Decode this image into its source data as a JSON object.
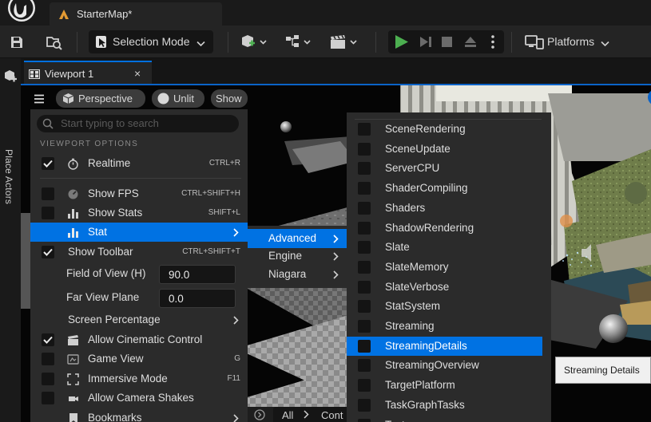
{
  "titlebar": {
    "doc_tab": "StarterMap*"
  },
  "toolbar": {
    "selection_mode": "Selection Mode",
    "platforms": "Platforms"
  },
  "left_strip": {
    "place_actors": "Place Actors"
  },
  "viewport": {
    "tab": "Viewport 1",
    "close": "×",
    "chips": {
      "perspective": "Perspective",
      "unlit": "Unlit",
      "show": "Show"
    }
  },
  "options_menu": {
    "search_placeholder": "Start typing to search",
    "section_header": "VIEWPORT OPTIONS",
    "realtime": {
      "label": "Realtime",
      "shortcut": "CTRL+R"
    },
    "show_fps": {
      "label": "Show FPS",
      "shortcut": "CTRL+SHIFT+H"
    },
    "show_stats": {
      "label": "Show Stats",
      "shortcut": "SHIFT+L"
    },
    "stat": {
      "label": "Stat"
    },
    "show_toolbar": {
      "label": "Show Toolbar",
      "shortcut": "CTRL+SHIFT+T"
    },
    "field_of_view": {
      "label": "Field of View (H)",
      "value": "90.0"
    },
    "far_view_plane": {
      "label": "Far View Plane",
      "value": "0.0"
    },
    "screen_percentage": {
      "label": "Screen Percentage"
    },
    "allow_cinematic_control": {
      "label": "Allow Cinematic Control"
    },
    "game_view": {
      "label": "Game View",
      "shortcut": "G"
    },
    "immersive_mode": {
      "label": "Immersive Mode",
      "shortcut": "F11"
    },
    "allow_camera_shakes": {
      "label": "Allow Camera Shakes"
    },
    "bookmarks": {
      "label": "Bookmarks"
    }
  },
  "stat_submenu": {
    "items": [
      "Advanced",
      "Engine",
      "Niagara"
    ]
  },
  "advanced_submenu": {
    "items": [
      "SceneRendering",
      "SceneUpdate",
      "ServerCPU",
      "ShaderCompiling",
      "Shaders",
      "ShadowRendering",
      "Slate",
      "SlateMemory",
      "SlateVerbose",
      "StatSystem",
      "Streaming",
      "StreamingDetails",
      "StreamingOverview",
      "TargetPlatform",
      "TaskGraphTasks",
      "Tests"
    ],
    "highlighted": "StreamingDetails"
  },
  "content_bar": {
    "all": "All",
    "breadcrumb": "Cont"
  },
  "tooltip": {
    "text": "Streaming Details"
  },
  "colors": {
    "accent": "#0072e3",
    "menu_bg": "#2b2b2b",
    "play_green": "#4caf50"
  }
}
